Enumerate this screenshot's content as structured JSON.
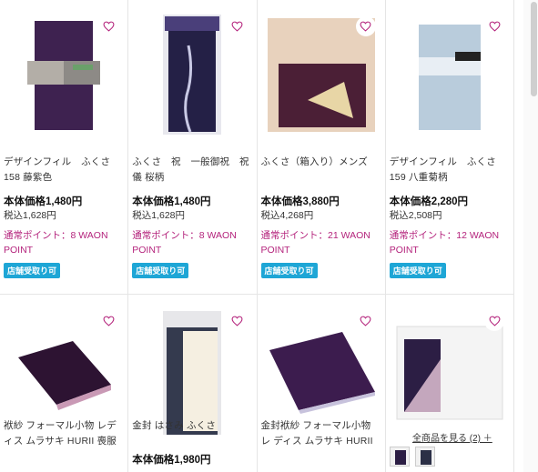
{
  "products_row1": [
    {
      "name": "デザインフィル　ふくさ158 藤紫色",
      "price": "本体価格1,480円",
      "tax": "税込1,628円",
      "point": "通常ポイント：8 WAON POINT",
      "badge": "店舗受取り可"
    },
    {
      "name": "ふくさ　祝　一般御祝　祝儀 桜柄",
      "price": "本体価格1,480円",
      "tax": "税込1,628円",
      "point": "通常ポイント：8 WAON POINT",
      "badge": "店舗受取り可"
    },
    {
      "name": "ふくさ（箱入り）メンズ",
      "price": "本体価格3,880円",
      "tax": "税込4,268円",
      "point": "通常ポイント：21 WAON POINT",
      "badge": "店舗受取り可"
    },
    {
      "name": "デザインフィル　ふくさ159 八重菊柄",
      "price": "本体価格2,280円",
      "tax": "税込2,508円",
      "point": "通常ポイント：12 WAON POINT",
      "badge": "店舗受取り可"
    }
  ],
  "products_row2": [
    {
      "name": "袱紗 フォーマル小物 レディス ムラサキ HURII 喪服 礼服..."
    },
    {
      "name": "金封 はさみ ふくさ",
      "price": "本体価格1,980円"
    },
    {
      "name": "金封袱紗 フォーマル小物 レ ディス ムラサキ HURII 喪服..."
    }
  ],
  "more_link": "全商品を見る (2) ＋",
  "colors": {
    "accent_pink": "#b4237c",
    "badge_blue": "#1ea6d6",
    "purple": "#3c2150"
  }
}
